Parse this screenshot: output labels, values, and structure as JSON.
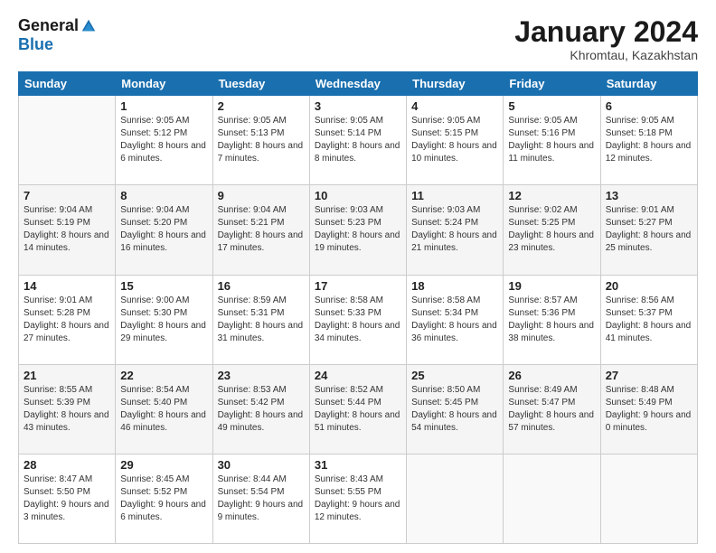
{
  "logo": {
    "general": "General",
    "blue": "Blue"
  },
  "title": "January 2024",
  "location": "Khromtau, Kazakhstan",
  "days_header": [
    "Sunday",
    "Monday",
    "Tuesday",
    "Wednesday",
    "Thursday",
    "Friday",
    "Saturday"
  ],
  "weeks": [
    [
      {
        "day": "",
        "sunrise": "",
        "sunset": "",
        "daylight": ""
      },
      {
        "day": "1",
        "sunrise": "Sunrise: 9:05 AM",
        "sunset": "Sunset: 5:12 PM",
        "daylight": "Daylight: 8 hours and 6 minutes."
      },
      {
        "day": "2",
        "sunrise": "Sunrise: 9:05 AM",
        "sunset": "Sunset: 5:13 PM",
        "daylight": "Daylight: 8 hours and 7 minutes."
      },
      {
        "day": "3",
        "sunrise": "Sunrise: 9:05 AM",
        "sunset": "Sunset: 5:14 PM",
        "daylight": "Daylight: 8 hours and 8 minutes."
      },
      {
        "day": "4",
        "sunrise": "Sunrise: 9:05 AM",
        "sunset": "Sunset: 5:15 PM",
        "daylight": "Daylight: 8 hours and 10 minutes."
      },
      {
        "day": "5",
        "sunrise": "Sunrise: 9:05 AM",
        "sunset": "Sunset: 5:16 PM",
        "daylight": "Daylight: 8 hours and 11 minutes."
      },
      {
        "day": "6",
        "sunrise": "Sunrise: 9:05 AM",
        "sunset": "Sunset: 5:18 PM",
        "daylight": "Daylight: 8 hours and 12 minutes."
      }
    ],
    [
      {
        "day": "7",
        "sunrise": "Sunrise: 9:04 AM",
        "sunset": "Sunset: 5:19 PM",
        "daylight": "Daylight: 8 hours and 14 minutes."
      },
      {
        "day": "8",
        "sunrise": "Sunrise: 9:04 AM",
        "sunset": "Sunset: 5:20 PM",
        "daylight": "Daylight: 8 hours and 16 minutes."
      },
      {
        "day": "9",
        "sunrise": "Sunrise: 9:04 AM",
        "sunset": "Sunset: 5:21 PM",
        "daylight": "Daylight: 8 hours and 17 minutes."
      },
      {
        "day": "10",
        "sunrise": "Sunrise: 9:03 AM",
        "sunset": "Sunset: 5:23 PM",
        "daylight": "Daylight: 8 hours and 19 minutes."
      },
      {
        "day": "11",
        "sunrise": "Sunrise: 9:03 AM",
        "sunset": "Sunset: 5:24 PM",
        "daylight": "Daylight: 8 hours and 21 minutes."
      },
      {
        "day": "12",
        "sunrise": "Sunrise: 9:02 AM",
        "sunset": "Sunset: 5:25 PM",
        "daylight": "Daylight: 8 hours and 23 minutes."
      },
      {
        "day": "13",
        "sunrise": "Sunrise: 9:01 AM",
        "sunset": "Sunset: 5:27 PM",
        "daylight": "Daylight: 8 hours and 25 minutes."
      }
    ],
    [
      {
        "day": "14",
        "sunrise": "Sunrise: 9:01 AM",
        "sunset": "Sunset: 5:28 PM",
        "daylight": "Daylight: 8 hours and 27 minutes."
      },
      {
        "day": "15",
        "sunrise": "Sunrise: 9:00 AM",
        "sunset": "Sunset: 5:30 PM",
        "daylight": "Daylight: 8 hours and 29 minutes."
      },
      {
        "day": "16",
        "sunrise": "Sunrise: 8:59 AM",
        "sunset": "Sunset: 5:31 PM",
        "daylight": "Daylight: 8 hours and 31 minutes."
      },
      {
        "day": "17",
        "sunrise": "Sunrise: 8:58 AM",
        "sunset": "Sunset: 5:33 PM",
        "daylight": "Daylight: 8 hours and 34 minutes."
      },
      {
        "day": "18",
        "sunrise": "Sunrise: 8:58 AM",
        "sunset": "Sunset: 5:34 PM",
        "daylight": "Daylight: 8 hours and 36 minutes."
      },
      {
        "day": "19",
        "sunrise": "Sunrise: 8:57 AM",
        "sunset": "Sunset: 5:36 PM",
        "daylight": "Daylight: 8 hours and 38 minutes."
      },
      {
        "day": "20",
        "sunrise": "Sunrise: 8:56 AM",
        "sunset": "Sunset: 5:37 PM",
        "daylight": "Daylight: 8 hours and 41 minutes."
      }
    ],
    [
      {
        "day": "21",
        "sunrise": "Sunrise: 8:55 AM",
        "sunset": "Sunset: 5:39 PM",
        "daylight": "Daylight: 8 hours and 43 minutes."
      },
      {
        "day": "22",
        "sunrise": "Sunrise: 8:54 AM",
        "sunset": "Sunset: 5:40 PM",
        "daylight": "Daylight: 8 hours and 46 minutes."
      },
      {
        "day": "23",
        "sunrise": "Sunrise: 8:53 AM",
        "sunset": "Sunset: 5:42 PM",
        "daylight": "Daylight: 8 hours and 49 minutes."
      },
      {
        "day": "24",
        "sunrise": "Sunrise: 8:52 AM",
        "sunset": "Sunset: 5:44 PM",
        "daylight": "Daylight: 8 hours and 51 minutes."
      },
      {
        "day": "25",
        "sunrise": "Sunrise: 8:50 AM",
        "sunset": "Sunset: 5:45 PM",
        "daylight": "Daylight: 8 hours and 54 minutes."
      },
      {
        "day": "26",
        "sunrise": "Sunrise: 8:49 AM",
        "sunset": "Sunset: 5:47 PM",
        "daylight": "Daylight: 8 hours and 57 minutes."
      },
      {
        "day": "27",
        "sunrise": "Sunrise: 8:48 AM",
        "sunset": "Sunset: 5:49 PM",
        "daylight": "Daylight: 9 hours and 0 minutes."
      }
    ],
    [
      {
        "day": "28",
        "sunrise": "Sunrise: 8:47 AM",
        "sunset": "Sunset: 5:50 PM",
        "daylight": "Daylight: 9 hours and 3 minutes."
      },
      {
        "day": "29",
        "sunrise": "Sunrise: 8:45 AM",
        "sunset": "Sunset: 5:52 PM",
        "daylight": "Daylight: 9 hours and 6 minutes."
      },
      {
        "day": "30",
        "sunrise": "Sunrise: 8:44 AM",
        "sunset": "Sunset: 5:54 PM",
        "daylight": "Daylight: 9 hours and 9 minutes."
      },
      {
        "day": "31",
        "sunrise": "Sunrise: 8:43 AM",
        "sunset": "Sunset: 5:55 PM",
        "daylight": "Daylight: 9 hours and 12 minutes."
      },
      {
        "day": "",
        "sunrise": "",
        "sunset": "",
        "daylight": ""
      },
      {
        "day": "",
        "sunrise": "",
        "sunset": "",
        "daylight": ""
      },
      {
        "day": "",
        "sunrise": "",
        "sunset": "",
        "daylight": ""
      }
    ]
  ]
}
